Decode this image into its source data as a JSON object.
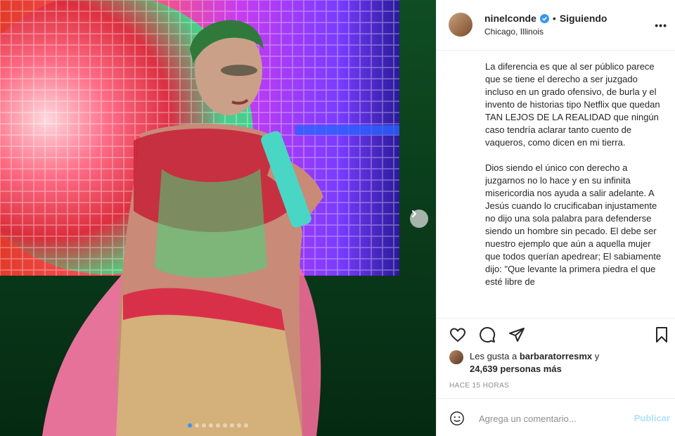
{
  "post": {
    "username": "ninelconde",
    "separator": "•",
    "follow_status": "Siguiendo",
    "location": "Chicago, Illinois",
    "more_icon": "more-horizontal-icon",
    "caption": "La diferencia es que al ser público parece que se tiene el derecho a ser juzgado incluso en un grado ofensivo, de burla y el invento de historias tipo Netflix que quedan TAN LEJOS DE LA REALIDAD que ningún caso tendría aclarar tanto cuento de vaqueros, como dicen en mi tierra.\n\nDios siendo el único con derecho a juzgarnos no lo hace y en su infinita misericordia nos ayuda a salir adelante. A Jesús cuando lo crucificaban injustamente no dijo una sola palabra para defenderse siendo un hombre sin pecado. El debe ser nuestro ejemplo que aún a aquella mujer que todos querían apedrear; El sabiamente dijo: \"Que levante la primera piedra el que esté libre de"
  },
  "likes": {
    "prefix": "Les gusta a ",
    "liker": "barbaratorresmx",
    "suffix": " y",
    "others": "24,639 personas más"
  },
  "timestamp": "HACE 15 HORAS",
  "comment": {
    "placeholder": "Agrega un comentario...",
    "publish_label": "Publicar"
  },
  "carousel": {
    "total": 9,
    "active": 1
  },
  "colors": {
    "accent": "#3897f0",
    "publish_disabled": "#b2dffc",
    "muted": "#8e8e8e",
    "text": "#262626"
  }
}
